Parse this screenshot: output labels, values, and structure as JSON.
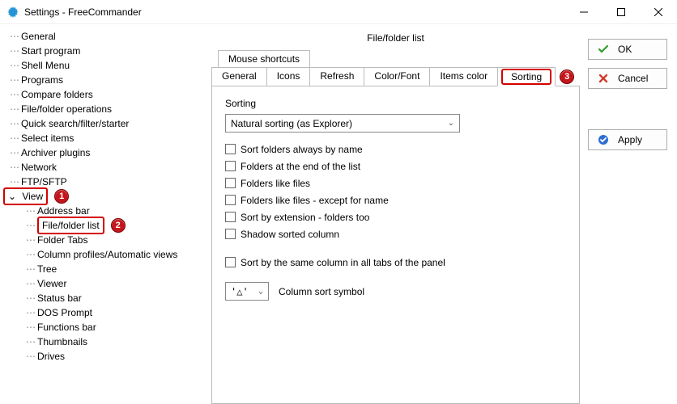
{
  "window": {
    "title": "Settings - FreeCommander"
  },
  "sidebar": {
    "items": [
      "General",
      "Start program",
      "Shell Menu",
      "Programs",
      "Compare folders",
      "File/folder operations",
      "Quick search/filter/starter",
      "Select items",
      "Archiver plugins",
      "Network",
      "FTP/SFTP"
    ],
    "view_label": "View",
    "view_children": [
      "Address bar",
      "File/folder list",
      "Folder Tabs",
      "Column profiles/Automatic views",
      "Tree",
      "Viewer",
      "Status bar",
      "DOS Prompt",
      "Functions bar",
      "Thumbnails",
      "Drives"
    ]
  },
  "panel": {
    "title": "File/folder list",
    "tabrow1": [
      "Mouse shortcuts"
    ],
    "tabrow2": [
      "General",
      "Icons",
      "Refresh",
      "Color/Font",
      "Items color",
      "Sorting"
    ],
    "sorting": {
      "group_label": "Sorting",
      "dropdown_value": "Natural sorting (as Explorer)",
      "checks": [
        "Sort folders always by name",
        "Folders at the end of the list",
        "Folders like files",
        "Folders like files - except for name",
        "Sort by extension - folders too",
        "Shadow sorted column"
      ],
      "check_same_column": "Sort by the same column in all tabs of the panel",
      "symbol_value": "'△'",
      "symbol_label": "Column sort symbol"
    }
  },
  "buttons": {
    "ok": "OK",
    "cancel": "Cancel",
    "apply": "Apply"
  },
  "badges": {
    "b1": "1",
    "b2": "2",
    "b3": "3"
  }
}
